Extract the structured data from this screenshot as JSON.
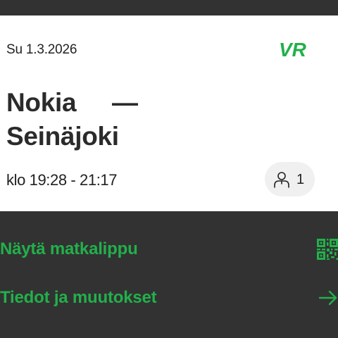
{
  "ticket": {
    "date": "Su 1.3.2026",
    "brand": "VR",
    "from": "Nokia",
    "separator": "—",
    "to": "Seinäjoki",
    "time": "klo 19:28 - 21:17",
    "passengers": "1",
    "passenger_icon": "person-icon"
  },
  "actions": {
    "show_ticket_label": "Näytä matkalippu",
    "show_ticket_icon": "qr-code-icon",
    "details_label": "Tiedot ja muutokset",
    "details_icon": "arrow-right-icon"
  },
  "colors": {
    "background": "#323232",
    "card": "#ffffff",
    "accent_green": "#22b04b",
    "text_dark": "#222222",
    "pill": "#f0f0f0"
  }
}
